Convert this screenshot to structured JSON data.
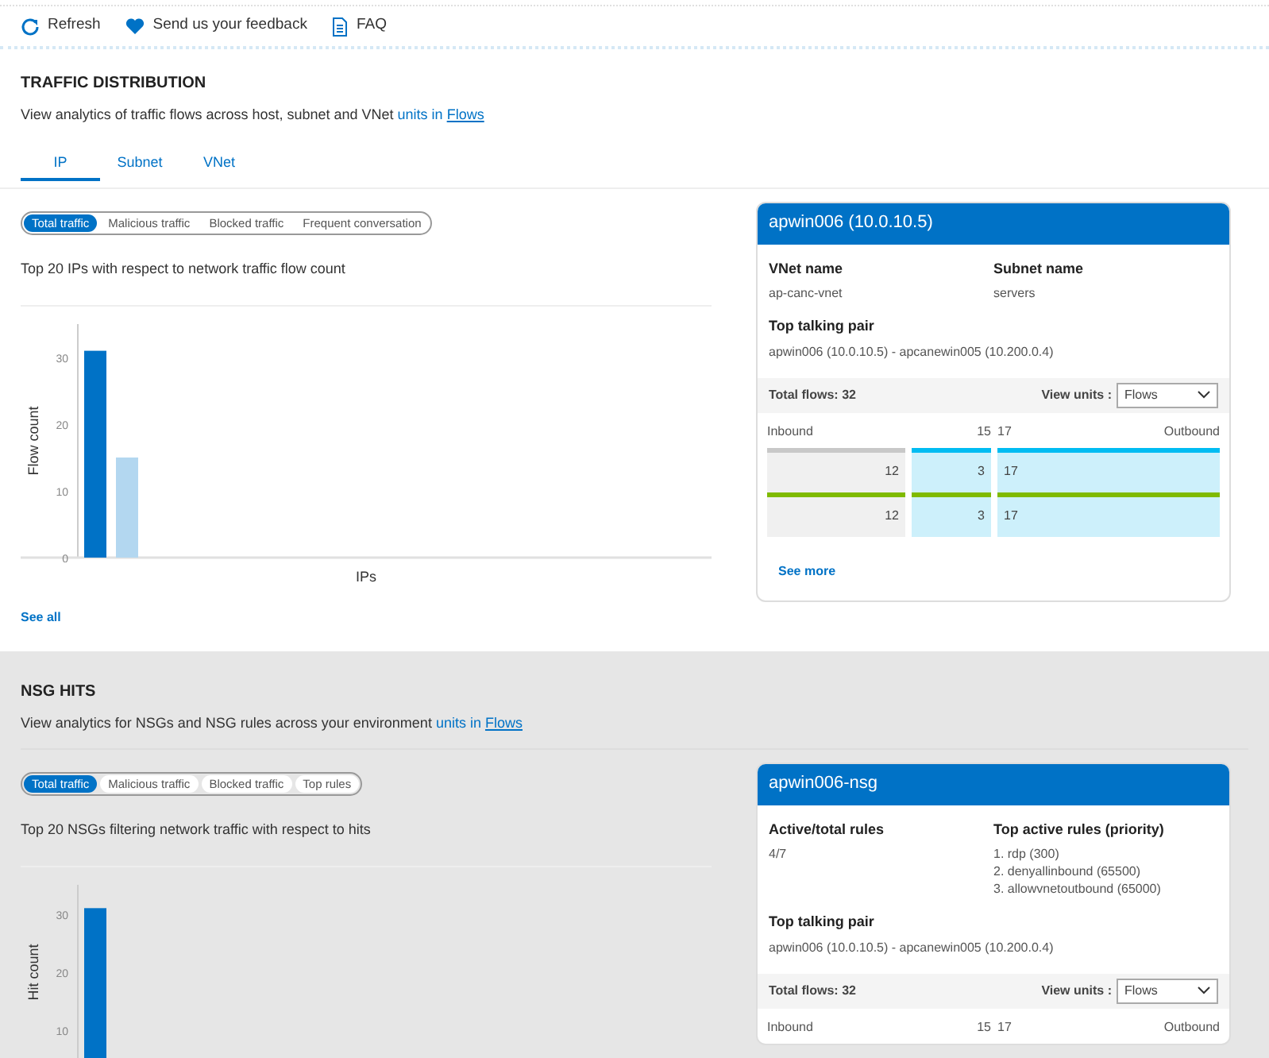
{
  "toolbar": [
    {
      "label": "Refresh"
    },
    {
      "label": "Send us your feedback"
    },
    {
      "label": "FAQ"
    }
  ],
  "sections": [
    {
      "title": "TRAFFIC DISTRIBUTION",
      "description": "View analytics of traffic flows across host, subnet and VNet",
      "units_note": "units in",
      "units_link": "Flows",
      "tabs": [
        {
          "label": "IP",
          "selected": true
        },
        {
          "label": "Subnet",
          "selected": false
        },
        {
          "label": "VNet",
          "selected": false
        }
      ],
      "filters": [
        {
          "label": "Total traffic",
          "selected": true
        },
        {
          "label": "Malicious traffic",
          "selected": false
        },
        {
          "label": "Blocked traffic",
          "selected": false
        },
        {
          "label": "Frequent conversation",
          "selected": false
        }
      ],
      "chart_title": "Top 20 IPs with respect to network traffic flow count",
      "x_axis_title": "IPs",
      "chart_data": {
        "type": "bar",
        "ylabel": "Flow count",
        "ylim": [
          0,
          35
        ],
        "yticks": [
          0,
          10,
          20,
          30
        ],
        "stacked": true,
        "series": [
          {
            "color": "#0072c6",
            "values": [
              31,
              null
            ]
          },
          {
            "color": "#b3d7f0",
            "values": [
              null,
              15
            ]
          }
        ]
      },
      "see_all": "See all",
      "card": {
        "header": "apwin006 (10.0.10.5)",
        "fields": [
          {
            "label": "VNet name",
            "values": [
              "ap-canc-vnet"
            ]
          },
          {
            "label": "Subnet name",
            "values": [
              "servers"
            ]
          }
        ],
        "pair_label": "Top talking pair",
        "pair_value": "apwin006 (10.0.10.5) - apcanewin005 (10.200.0.4)",
        "total_flows": "Total flows: 32",
        "units_label": "View units :",
        "units_value": "Flows",
        "flow_header": {
          "inbound": "Inbound",
          "inbound_total": "15",
          "outbound_total": "17",
          "outbound": "Outbound"
        },
        "flow_rows": [
          {
            "cells": [
              {
                "text": "12",
                "color": "#c8c8c8"
              },
              {
                "text": "3",
                "color": "#00bcf2"
              },
              {
                "text": "17",
                "color": "#00bcf2"
              }
            ]
          },
          {
            "cells": [
              {
                "text": "12",
                "color": "#7fba00"
              },
              {
                "text": "3",
                "color": "#7fba00"
              },
              {
                "text": "17",
                "color": "#7fba00"
              }
            ]
          }
        ],
        "see_more": "See more"
      }
    },
    {
      "title": "NSG HITS",
      "description": "View analytics for NSGs and NSG rules across your environment",
      "units_note": "units in",
      "units_link": "Flows",
      "filters": [
        {
          "label": "Total traffic",
          "selected": true
        },
        {
          "label": "Malicious traffic",
          "selected": false
        },
        {
          "label": "Blocked traffic",
          "selected": false
        },
        {
          "label": "Top rules",
          "selected": false
        }
      ],
      "chart_title": "Top 20 NSGs filtering network traffic with respect to hits",
      "chart_data": {
        "type": "bar",
        "ylabel": "Hit count",
        "ylim": [
          5,
          35
        ],
        "yticks": [
          10,
          20,
          30
        ],
        "series": [
          {
            "color": "#0072c6",
            "values": [
              31
            ]
          }
        ]
      },
      "card": {
        "header": "apwin006-nsg",
        "fields": [
          {
            "label": "Active/total rules",
            "values": [
              "4/7"
            ]
          },
          {
            "label": "Top active rules (priority)",
            "values": [
              "1. rdp (300)",
              "2. denyallinbound (65500)",
              "3. allowvnetoutbound (65000)"
            ]
          }
        ],
        "pair_label": "Top talking pair",
        "pair_value": "apwin006 (10.0.10.5) - apcanewin005 (10.200.0.4)",
        "total_flows": "Total flows: 32",
        "units_label": "View units :",
        "units_value": "Flows",
        "flow_header": {
          "inbound": "Inbound",
          "inbound_total": "15",
          "outbound_total": "17",
          "outbound": "Outbound"
        }
      }
    }
  ]
}
